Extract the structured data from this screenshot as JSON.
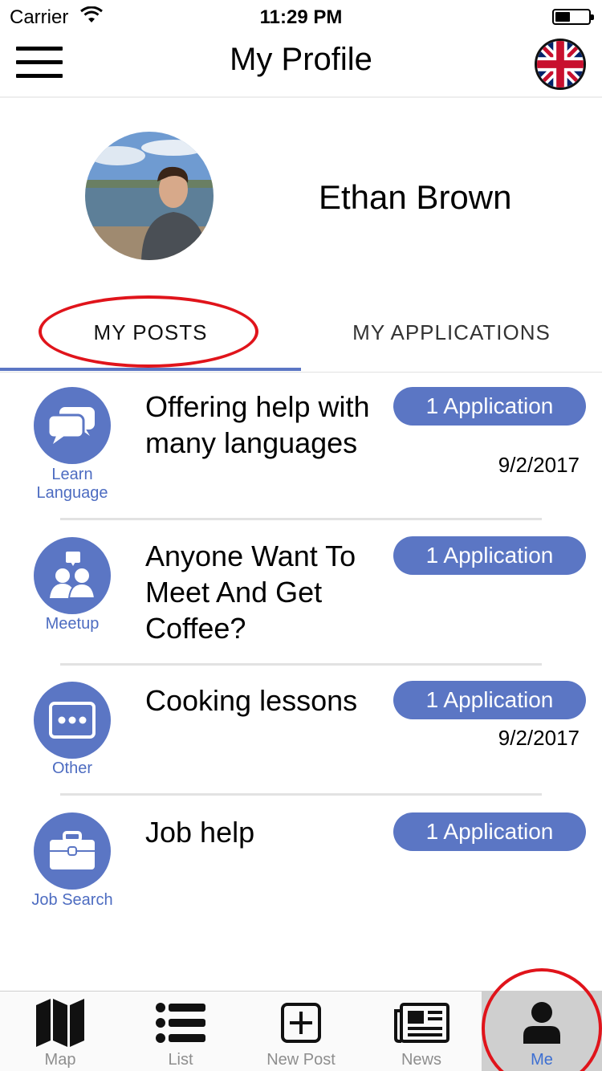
{
  "status_bar": {
    "carrier": "Carrier",
    "time": "11:29 PM"
  },
  "header": {
    "title": "My Profile"
  },
  "profile": {
    "name": "Ethan Brown"
  },
  "tabs": [
    {
      "label": "MY POSTS"
    },
    {
      "label": "MY APPLICATIONS"
    }
  ],
  "posts": [
    {
      "category": "Learn Language",
      "icon": "speech-bubbles-icon",
      "title": "Offering help with many languages",
      "applications": "1 Application",
      "date": "9/2/2017"
    },
    {
      "category": "Meetup",
      "icon": "people-icon",
      "title": "Anyone Want To Meet And Get Coffee?",
      "applications": "1 Application",
      "date": ""
    },
    {
      "category": "Other",
      "icon": "ellipsis-icon",
      "title": "Cooking lessons",
      "applications": "1 Application",
      "date": "9/2/2017"
    },
    {
      "category": "Job Search",
      "icon": "briefcase-icon",
      "title": "Job help",
      "applications": "1 Application",
      "date": ""
    }
  ],
  "tab_bar": [
    {
      "label": "Map",
      "icon": "map-icon"
    },
    {
      "label": "List",
      "icon": "list-icon"
    },
    {
      "label": "New Post",
      "icon": "plus-square-icon"
    },
    {
      "label": "News",
      "icon": "newspaper-icon"
    },
    {
      "label": "Me",
      "icon": "person-icon",
      "active": true
    }
  ],
  "colors": {
    "accent": "#5b76c4",
    "annotation": "#e0141b",
    "active_tab": "#3d6fd2"
  }
}
